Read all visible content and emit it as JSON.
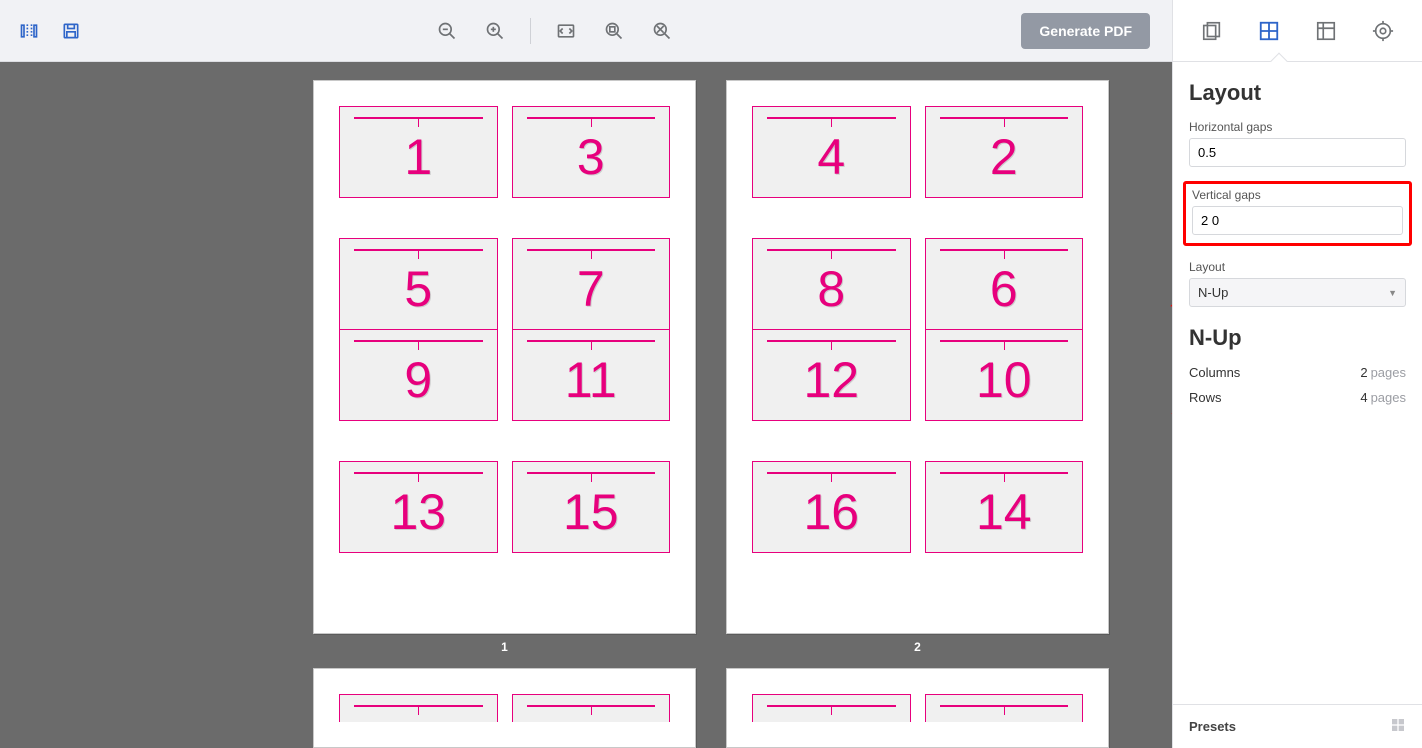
{
  "toolbar": {
    "generate_label": "Generate PDF"
  },
  "sheets": [
    {
      "label": "1",
      "rows": [
        [
          "1",
          "3"
        ],
        [
          "5",
          "7"
        ],
        [
          "9",
          "11"
        ],
        [
          "13",
          "15"
        ]
      ]
    },
    {
      "label": "2",
      "rows": [
        [
          "4",
          "2"
        ],
        [
          "8",
          "6"
        ],
        [
          "12",
          "10"
        ],
        [
          "16",
          "14"
        ]
      ]
    }
  ],
  "sidebar": {
    "panel_title": "Layout",
    "hgaps_label": "Horizontal gaps",
    "hgaps_value": "0.5",
    "vgaps_label": "Vertical gaps",
    "vgaps_value": "2 0",
    "layout_label": "Layout",
    "layout_value": "N-Up",
    "nup_title": "N-Up",
    "columns_label": "Columns",
    "columns_value": "2",
    "rows_label": "Rows",
    "rows_value": "4",
    "unit": "pages",
    "presets_label": "Presets"
  }
}
